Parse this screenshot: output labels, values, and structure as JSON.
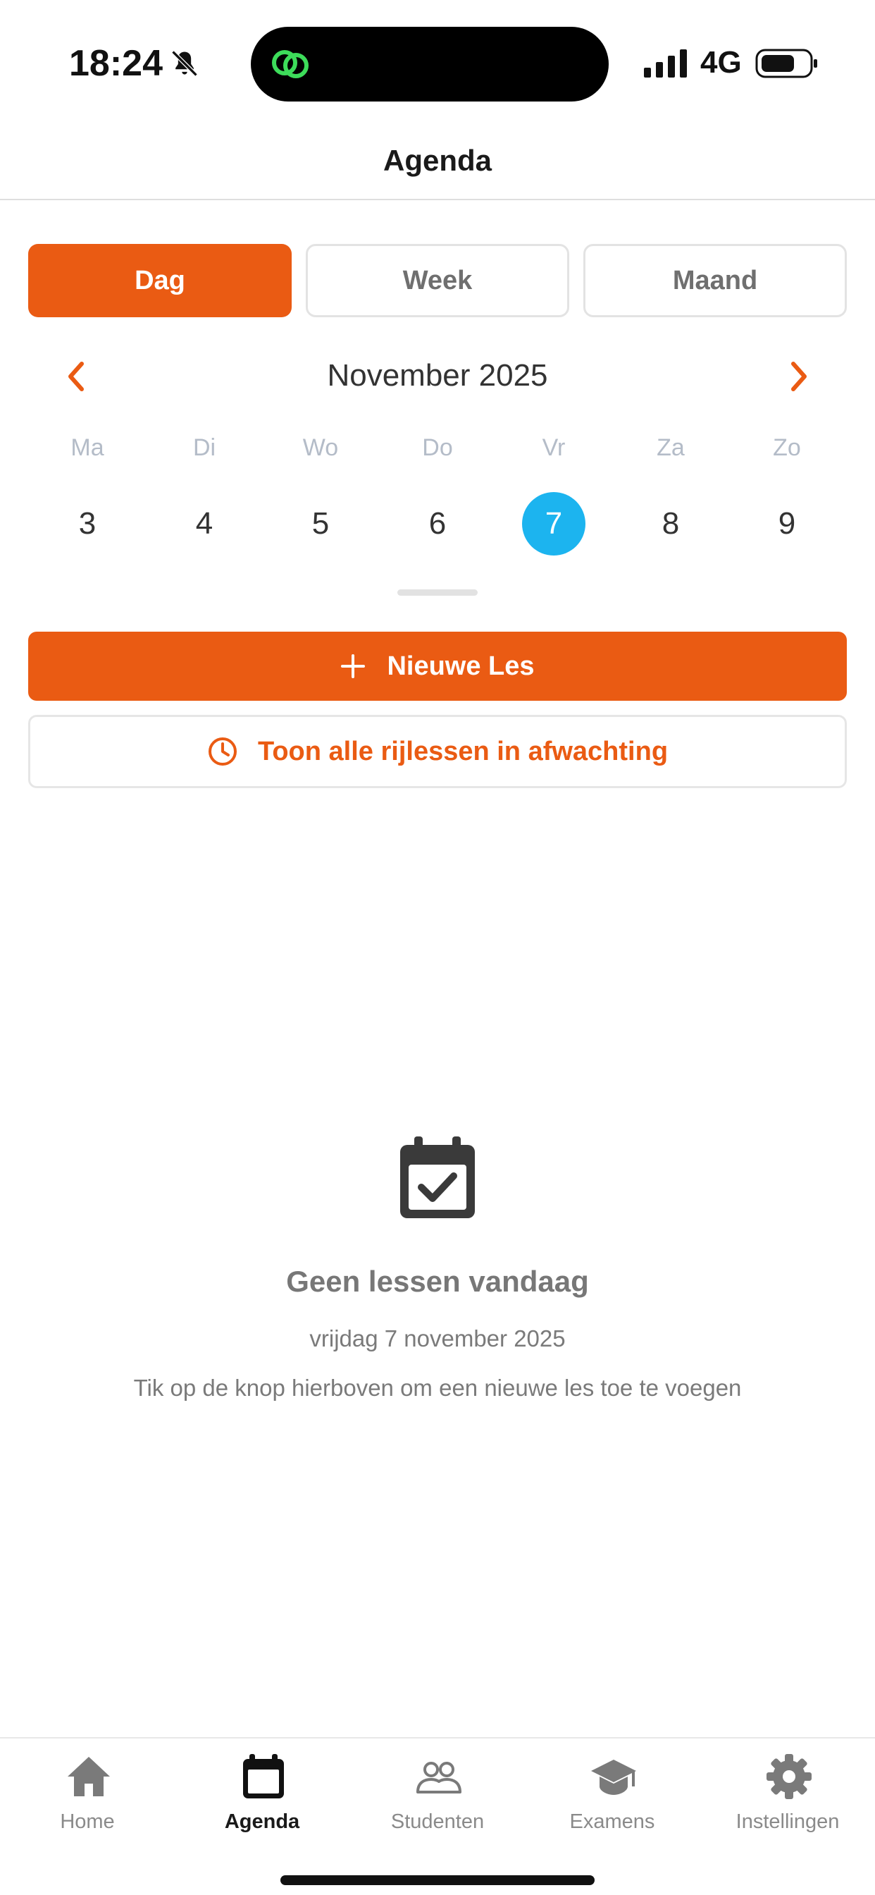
{
  "status_bar": {
    "time": "18:24",
    "network": "4G",
    "icons": [
      "bell-slash-icon",
      "link-icon",
      "signal-icon",
      "battery-icon"
    ]
  },
  "header": {
    "title": "Agenda"
  },
  "view_selector": {
    "options": [
      "Dag",
      "Week",
      "Maand"
    ],
    "selected": "Dag"
  },
  "calendar": {
    "month_label": "November 2025",
    "weekdays": [
      "Ma",
      "Di",
      "Wo",
      "Do",
      "Vr",
      "Za",
      "Zo"
    ],
    "days": [
      "3",
      "4",
      "5",
      "6",
      "7",
      "8",
      "9"
    ],
    "selected_day": "7"
  },
  "actions": {
    "new_lesson": "Nieuwe Les",
    "pending_lessons": "Toon alle rijlessen in afwachting"
  },
  "empty_state": {
    "title": "Geen lessen vandaag",
    "date": "vrijdag 7 november 2025",
    "hint": "Tik op de knop hierboven om een nieuwe les toe te voegen"
  },
  "tabbar": {
    "items": [
      {
        "label": "Home",
        "icon": "home-icon"
      },
      {
        "label": "Agenda",
        "icon": "calendar-icon"
      },
      {
        "label": "Studenten",
        "icon": "people-icon"
      },
      {
        "label": "Examens",
        "icon": "graduation-cap-icon"
      },
      {
        "label": "Instellingen",
        "icon": "gear-icon"
      }
    ],
    "active": "Agenda"
  },
  "colors": {
    "accent": "#ea5b13",
    "selected_day": "#1cb4ef",
    "weekday_text": "#b4bcc8",
    "muted_text": "#7a7a7a"
  }
}
